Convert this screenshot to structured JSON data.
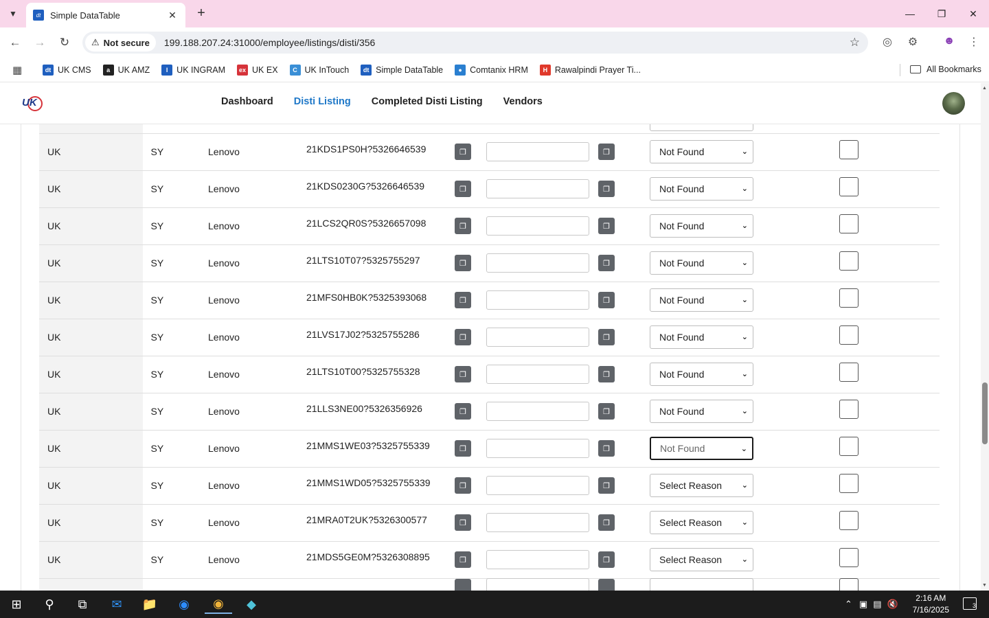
{
  "browser": {
    "tab_title": "Simple DataTable",
    "tab_favicon_text": "dt",
    "security_label": "Not secure",
    "url": "199.188.207.24:31000/employee/listings/disti/356"
  },
  "bookmarks": [
    {
      "label": "UK CMS",
      "icon": "cms-icon",
      "color": "#1f5fbf",
      "glyph": "dt"
    },
    {
      "label": "UK AMZ",
      "icon": "amazon-icon",
      "color": "#222222",
      "glyph": "a"
    },
    {
      "label": "UK INGRAM",
      "icon": "ingram-icon",
      "color": "#1f5fbf",
      "glyph": "I"
    },
    {
      "label": "UK EX",
      "icon": "ex-icon",
      "color": "#d6333a",
      "glyph": "ex"
    },
    {
      "label": "UK InTouch",
      "icon": "intouch-icon",
      "color": "#3a8fd6",
      "glyph": "C"
    },
    {
      "label": "Simple DataTable",
      "icon": "datatable-icon",
      "color": "#1f5fbf",
      "glyph": "dt"
    },
    {
      "label": "Comtanix HRM",
      "icon": "hrm-icon",
      "color": "#2a7fd0",
      "glyph": "●"
    },
    {
      "label": "Rawalpindi Prayer Ti...",
      "icon": "prayer-icon",
      "color": "#e0392b",
      "glyph": "H"
    }
  ],
  "all_bookmarks_label": "All Bookmarks",
  "app_nav": [
    {
      "label": "Dashboard",
      "active": false
    },
    {
      "label": "Disti Listing",
      "active": true
    },
    {
      "label": "Completed Disti Listing",
      "active": false
    },
    {
      "label": "Vendors",
      "active": false
    }
  ],
  "rows": [
    {
      "country": "UK",
      "code": "SY",
      "brand": "Lenovo",
      "sku": "21KDS1PS0H?5326646539",
      "reason": "Not Found",
      "focused": false
    },
    {
      "country": "UK",
      "code": "SY",
      "brand": "Lenovo",
      "sku": "21KDS0230G?5326646539",
      "reason": "Not Found",
      "focused": false
    },
    {
      "country": "UK",
      "code": "SY",
      "brand": "Lenovo",
      "sku": "21LCS2QR0S?5326657098",
      "reason": "Not Found",
      "focused": false
    },
    {
      "country": "UK",
      "code": "SY",
      "brand": "Lenovo",
      "sku": "21LTS10T07?5325755297",
      "reason": "Not Found",
      "focused": false
    },
    {
      "country": "UK",
      "code": "SY",
      "brand": "Lenovo",
      "sku": "21MFS0HB0K?5325393068",
      "reason": "Not Found",
      "focused": false
    },
    {
      "country": "UK",
      "code": "SY",
      "brand": "Lenovo",
      "sku": "21LVS17J02?5325755286",
      "reason": "Not Found",
      "focused": false
    },
    {
      "country": "UK",
      "code": "SY",
      "brand": "Lenovo",
      "sku": "21LTS10T00?5325755328",
      "reason": "Not Found",
      "focused": false
    },
    {
      "country": "UK",
      "code": "SY",
      "brand": "Lenovo",
      "sku": "21LLS3NE00?5326356926",
      "reason": "Not Found",
      "focused": false
    },
    {
      "country": "UK",
      "code": "SY",
      "brand": "Lenovo",
      "sku": "21MMS1WE03?5325755339",
      "reason": "Not Found",
      "focused": true
    },
    {
      "country": "UK",
      "code": "SY",
      "brand": "Lenovo",
      "sku": "21MMS1WD05?5325755339",
      "reason": "Select Reason",
      "focused": false
    },
    {
      "country": "UK",
      "code": "SY",
      "brand": "Lenovo",
      "sku": "21MRA0T2UK?5326300577",
      "reason": "Select Reason",
      "focused": false
    },
    {
      "country": "UK",
      "code": "SY",
      "brand": "Lenovo",
      "sku": "21MDS5GE0M?5326308895",
      "reason": "Select Reason",
      "focused": false
    }
  ],
  "taskbar": {
    "time": "2:16 AM",
    "date": "7/16/2025",
    "notification_count": "3"
  }
}
